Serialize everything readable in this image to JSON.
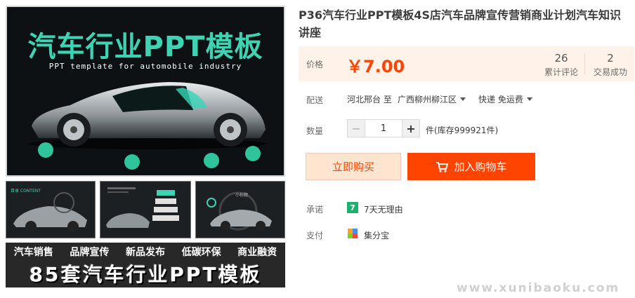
{
  "product": {
    "title": "P36汽车行业PPT模板4S店汽车品牌宣传营销商业计划汽车知识讲座",
    "image": {
      "hero_title": "汽车行业PPT模板",
      "hero_subtitle": "PPT template for automobile industry",
      "thumb_labels": [
        "目录 CONTENT",
        "",
        "小标题"
      ],
      "banner_tags": [
        "汽车销售",
        "品牌宣传",
        "新品发布",
        "低碳环保",
        "商业融资"
      ],
      "banner_title": "85套汽车行业PPT模板"
    }
  },
  "price": {
    "label": "价格",
    "value": "￥7.00",
    "accent_color": "#ff4400"
  },
  "stats": {
    "reviews_count": "26",
    "reviews_label": "累计评论",
    "trades_count": "2",
    "trades_label": "交易成功"
  },
  "delivery": {
    "label": "配送",
    "from": "河北邢台 至",
    "to": "广西柳州柳江区",
    "method": "快递 免运费"
  },
  "quantity": {
    "label": "数量",
    "value": "1",
    "minus": "−",
    "plus": "+",
    "stock": "件(库存999921件)"
  },
  "actions": {
    "buy_now": "立即购买",
    "add_to_cart": "加入购物车"
  },
  "promise": {
    "label": "承诺",
    "badge": "7",
    "text": "7天无理由",
    "icon": "seven-day-icon"
  },
  "payment": {
    "label": "支付",
    "text": "集分宝",
    "icon": "jifenbao-icon"
  },
  "watermark": "www.xunibaoku.com"
}
